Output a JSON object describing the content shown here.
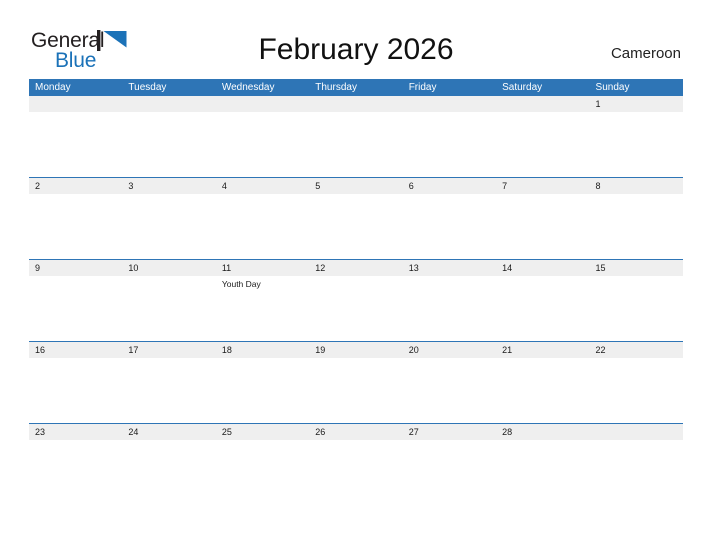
{
  "brand": {
    "name_part1": "General",
    "name_part2": "Blue",
    "flag_icon": "blue-triangle-flag-icon",
    "colors": {
      "dark_text": "#231f20",
      "blue_text": "#1b72b8",
      "header_blue": "#2e75b6",
      "band_gray": "#efefef"
    }
  },
  "header": {
    "title": "February 2026",
    "country": "Cameroon"
  },
  "calendar": {
    "weekdays": [
      "Monday",
      "Tuesday",
      "Wednesday",
      "Thursday",
      "Friday",
      "Saturday",
      "Sunday"
    ],
    "weeks": [
      {
        "days": [
          {
            "number": "",
            "events": []
          },
          {
            "number": "",
            "events": []
          },
          {
            "number": "",
            "events": []
          },
          {
            "number": "",
            "events": []
          },
          {
            "number": "",
            "events": []
          },
          {
            "number": "",
            "events": []
          },
          {
            "number": "1",
            "events": []
          }
        ]
      },
      {
        "days": [
          {
            "number": "2",
            "events": []
          },
          {
            "number": "3",
            "events": []
          },
          {
            "number": "4",
            "events": []
          },
          {
            "number": "5",
            "events": []
          },
          {
            "number": "6",
            "events": []
          },
          {
            "number": "7",
            "events": []
          },
          {
            "number": "8",
            "events": []
          }
        ]
      },
      {
        "days": [
          {
            "number": "9",
            "events": []
          },
          {
            "number": "10",
            "events": []
          },
          {
            "number": "11",
            "events": [
              "Youth Day"
            ]
          },
          {
            "number": "12",
            "events": []
          },
          {
            "number": "13",
            "events": []
          },
          {
            "number": "14",
            "events": []
          },
          {
            "number": "15",
            "events": []
          }
        ]
      },
      {
        "days": [
          {
            "number": "16",
            "events": []
          },
          {
            "number": "17",
            "events": []
          },
          {
            "number": "18",
            "events": []
          },
          {
            "number": "19",
            "events": []
          },
          {
            "number": "20",
            "events": []
          },
          {
            "number": "21",
            "events": []
          },
          {
            "number": "22",
            "events": []
          }
        ]
      },
      {
        "days": [
          {
            "number": "23",
            "events": []
          },
          {
            "number": "24",
            "events": []
          },
          {
            "number": "25",
            "events": []
          },
          {
            "number": "26",
            "events": []
          },
          {
            "number": "27",
            "events": []
          },
          {
            "number": "28",
            "events": []
          },
          {
            "number": "",
            "events": []
          }
        ]
      }
    ]
  }
}
